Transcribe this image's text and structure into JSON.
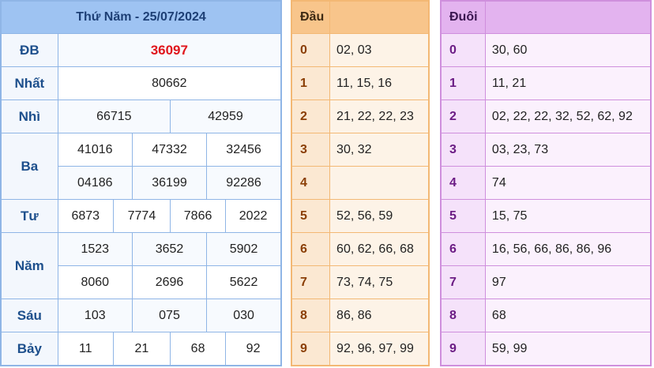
{
  "results": {
    "title": "Thứ Năm - 25/07/2024",
    "rows": [
      {
        "label": "ĐB",
        "values": [
          "36097"
        ]
      },
      {
        "label": "Nhất",
        "values": [
          "80662"
        ]
      },
      {
        "label": "Nhì",
        "values": [
          "66715",
          "42959"
        ]
      },
      {
        "label": "Ba",
        "values": [
          "41016",
          "47332",
          "32456",
          "04186",
          "36199",
          "92286"
        ]
      },
      {
        "label": "Tư",
        "values": [
          "6873",
          "7774",
          "7866",
          "2022"
        ]
      },
      {
        "label": "Năm",
        "values": [
          "1523",
          "3652",
          "5902",
          "8060",
          "2696",
          "5622"
        ]
      },
      {
        "label": "Sáu",
        "values": [
          "103",
          "075",
          "030"
        ]
      },
      {
        "label": "Bảy",
        "values": [
          "11",
          "21",
          "68",
          "92"
        ]
      }
    ]
  },
  "dau": {
    "header": "Đầu",
    "rows": [
      {
        "digit": "0",
        "values": "02, 03"
      },
      {
        "digit": "1",
        "values": "11, 15, 16"
      },
      {
        "digit": "2",
        "values": "21, 22, 22, 23"
      },
      {
        "digit": "3",
        "values": "30, 32"
      },
      {
        "digit": "4",
        "values": ""
      },
      {
        "digit": "5",
        "values": "52, 56, 59"
      },
      {
        "digit": "6",
        "values": "60, 62, 66, 68"
      },
      {
        "digit": "7",
        "values": "73, 74, 75"
      },
      {
        "digit": "8",
        "values": "86, 86"
      },
      {
        "digit": "9",
        "values": "92, 96, 97, 99"
      }
    ]
  },
  "duoi": {
    "header": "Đuôi",
    "rows": [
      {
        "digit": "0",
        "values": "30, 60"
      },
      {
        "digit": "1",
        "values": "11, 21"
      },
      {
        "digit": "2",
        "values": "02, 22, 22, 32, 52, 62, 92"
      },
      {
        "digit": "3",
        "values": "03, 23, 73"
      },
      {
        "digit": "4",
        "values": "74"
      },
      {
        "digit": "5",
        "values": "15, 75"
      },
      {
        "digit": "6",
        "values": "16, 56, 66, 86, 86, 96"
      },
      {
        "digit": "7",
        "values": "97"
      },
      {
        "digit": "8",
        "values": "68"
      },
      {
        "digit": "9",
        "values": "59, 99"
      }
    ]
  }
}
